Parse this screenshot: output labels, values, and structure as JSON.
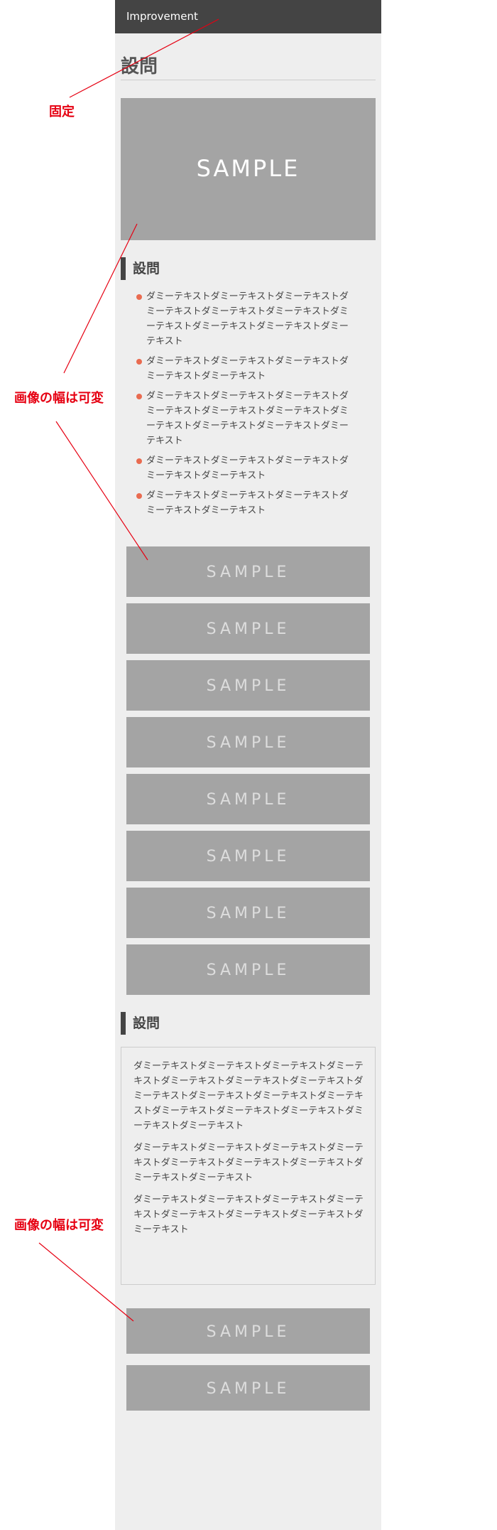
{
  "app": {
    "title": "Improvement"
  },
  "page": {
    "title": "設問"
  },
  "hero_image": {
    "label": "SAMPLE"
  },
  "section1": {
    "heading": "設問",
    "items": [
      "ダミーテキストダミーテキストダミーテキストダミーテキストダミーテキストダミーテキストダミーテキストダミーテキストダミーテキストダミーテキスト",
      "ダミーテキストダミーテキストダミーテキストダミーテキストダミーテキスト",
      "ダミーテキストダミーテキストダミーテキストダミーテキストダミーテキストダミーテキストダミーテキストダミーテキストダミーテキストダミーテキスト",
      "ダミーテキストダミーテキストダミーテキストダミーテキストダミーテキスト",
      "ダミーテキストダミーテキストダミーテキストダミーテキストダミーテキスト"
    ]
  },
  "banner_list": {
    "labels": [
      "SAMPLE",
      "SAMPLE",
      "SAMPLE",
      "SAMPLE",
      "SAMPLE",
      "SAMPLE",
      "SAMPLE",
      "SAMPLE"
    ]
  },
  "section2": {
    "heading": "設問",
    "paragraphs": [
      "ダミーテキストダミーテキストダミーテキストダミーテキストダミーテキストダミーテキストダミーテキストダミーテキストダミーテキストダミーテキストダミーテキストダミーテキストダミーテキストダミーテキストダミーテキストダミーテキスト",
      "ダミーテキストダミーテキストダミーテキストダミーテキストダミーテキストダミーテキストダミーテキストダミーテキストダミーテキスト",
      "ダミーテキストダミーテキストダミーテキストダミーテキストダミーテキストダミーテキストダミーテキストダミーテキスト"
    ]
  },
  "bottom_banners": {
    "labels": [
      "SAMPLE",
      "SAMPLE"
    ]
  },
  "annotations": {
    "fixed": "固定",
    "variable_width_1": "画像の幅は可変",
    "variable_width_2": "画像の幅は可変"
  },
  "colors": {
    "header_bg": "#444444",
    "page_bg": "#eeeeee",
    "image_placeholder": "#a4a4a4",
    "bullet": "#e96b50",
    "annotation": "#e60012"
  }
}
